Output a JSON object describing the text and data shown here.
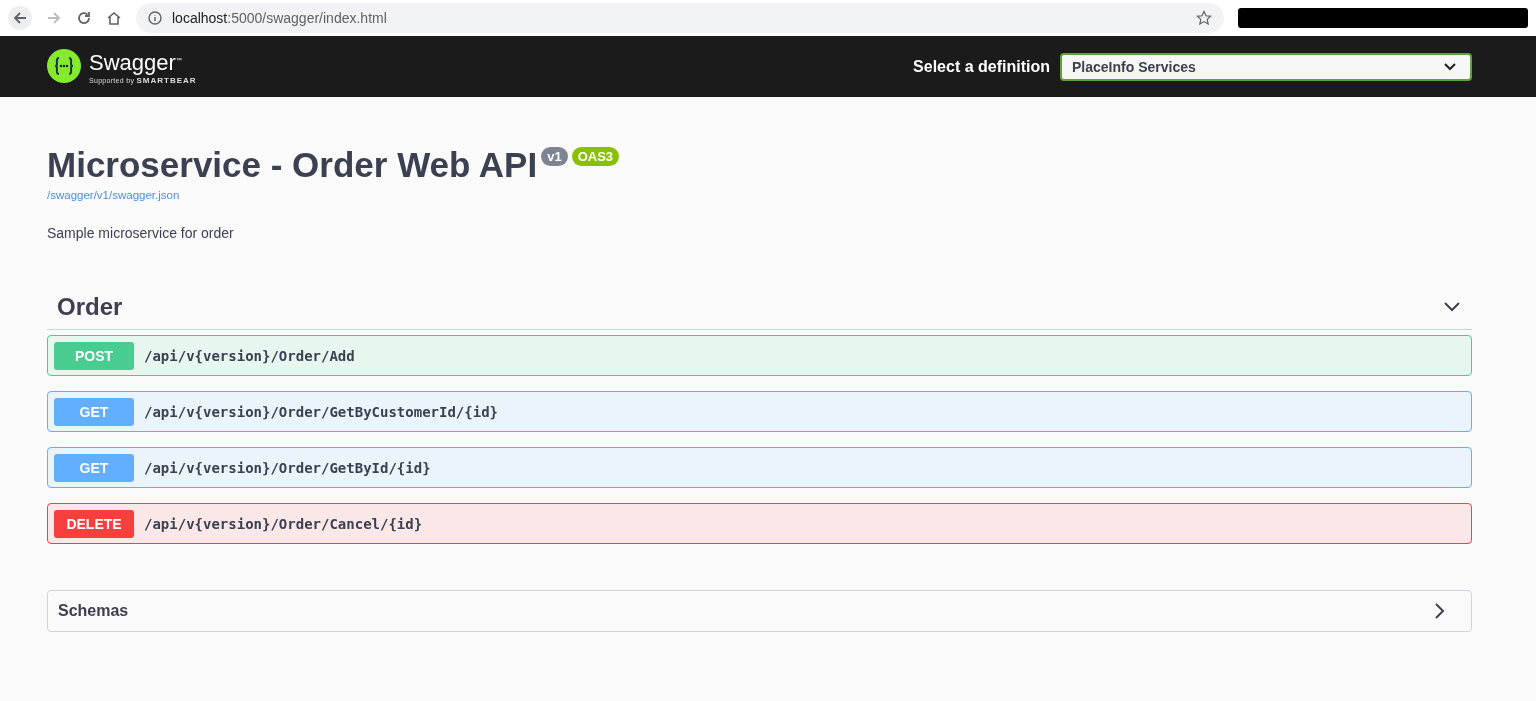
{
  "browser": {
    "url_host": "localhost",
    "url_rest": ":5000/swagger/index.html"
  },
  "topbar": {
    "logo_text": "Swagger",
    "logo_tm": "™",
    "logo_sub": "Supported by",
    "logo_brand": "SMARTBEAR",
    "definition_label": "Select a definition",
    "definition_value": "PlaceInfo Services"
  },
  "info": {
    "title": "Microservice - Order Web API",
    "version": "v1",
    "oas": "OAS3",
    "spec_link": "/swagger/v1/swagger.json",
    "description": "Sample microservice for order"
  },
  "tag": {
    "name": "Order",
    "expanded": true,
    "operations": [
      {
        "kind": "post",
        "method": "POST",
        "path": "/api/v{version}/Order/Add"
      },
      {
        "kind": "get",
        "method": "GET",
        "path": "/api/v{version}/Order/GetByCustomerId/{id}"
      },
      {
        "kind": "get",
        "method": "GET",
        "path": "/api/v{version}/Order/GetById/{id}"
      },
      {
        "kind": "delete",
        "method": "DELETE",
        "path": "/api/v{version}/Order/Cancel/{id}"
      }
    ]
  },
  "schemas": {
    "title": "Schemas",
    "expanded": false
  }
}
